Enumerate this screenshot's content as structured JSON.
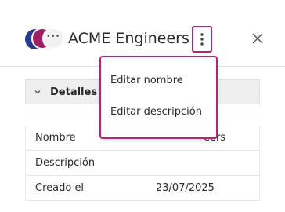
{
  "header": {
    "title": "ACME Engineers",
    "avatars": [
      "avatar-blue",
      "avatar-magenta",
      "avatar-more"
    ],
    "avatar_more_label": "•••"
  },
  "menu": {
    "items": [
      {
        "label": "Editar nombre"
      },
      {
        "label": "Editar descripción"
      }
    ]
  },
  "details": {
    "title": "Detalles",
    "rows": [
      {
        "key": "Nombre",
        "value": "eers"
      },
      {
        "key": "Descripción",
        "value": ""
      },
      {
        "key": "Creado el",
        "value": "23/07/2025"
      }
    ]
  },
  "colors": {
    "accent": "#b3237a",
    "avatar_blue": "#2b3a8c",
    "avatar_magenta": "#9e1f63",
    "header_bg": "#efefef"
  },
  "icons": [
    "more-vertical-icon",
    "close-icon",
    "chevron-down-icon"
  ]
}
